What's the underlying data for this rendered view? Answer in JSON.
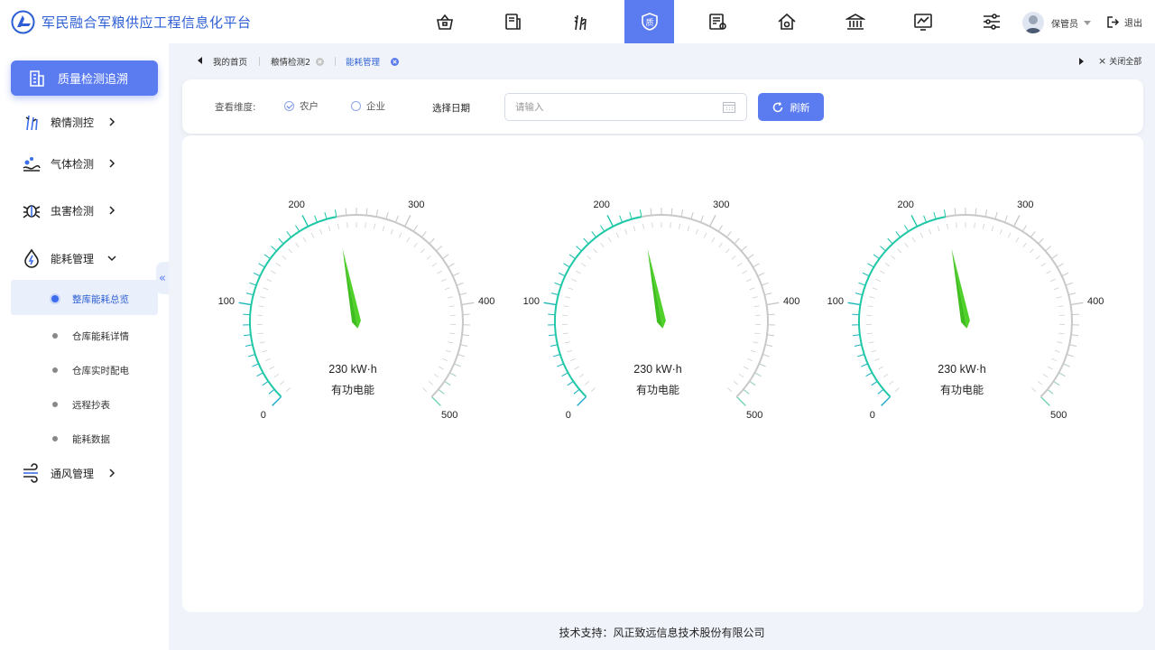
{
  "header": {
    "title": "军民融合军粮供应工程信息化平台",
    "nav_icons": [
      "storage-icon",
      "document-icon",
      "grain-icon",
      "quality-icon",
      "report-icon",
      "warehouse-icon",
      "bank-icon",
      "monitor-icon",
      "settings-sliders-icon"
    ],
    "active_nav_index": 3,
    "active_nav_label": "质",
    "user": "保管员",
    "logout": "退出"
  },
  "sidebar": {
    "primary": "质量检测追溯",
    "menus": [
      {
        "label": "粮情测控",
        "icon": "wheat-icon"
      },
      {
        "label": "气体检测",
        "icon": "gas-icon"
      },
      {
        "label": "虫害检测",
        "icon": "bug-icon"
      },
      {
        "label": "能耗管理",
        "icon": "energy-icon"
      },
      {
        "label": "通风管理",
        "icon": "wind-icon"
      }
    ],
    "subitems": [
      "整库能耗总览",
      "仓库能耗详情",
      "仓库实时配电",
      "远程抄表",
      "能耗数据"
    ],
    "active_sub": 0,
    "collapse_glyph": "«"
  },
  "tabs": {
    "items": [
      "我的首页",
      "粮情检测2",
      "能耗管理"
    ],
    "active": 2,
    "close_all": "关闭全部"
  },
  "filter": {
    "dimension_label": "查看维度:",
    "options": [
      "农户",
      "企业"
    ],
    "selected": 0,
    "date_label": "选择日期",
    "date_placeholder": "请输入",
    "refresh": "刷新"
  },
  "gauges": [
    {
      "value": 230,
      "unit": "kW·h",
      "display": "230 kW·h",
      "name": "有功电能",
      "min": 0,
      "max": 500,
      "labels": [
        "0",
        "100",
        "200",
        "300",
        "400",
        "500"
      ]
    },
    {
      "value": 230,
      "unit": "kW·h",
      "display": "230 kW·h",
      "name": "有功电能",
      "min": 0,
      "max": 500,
      "labels": [
        "0",
        "100",
        "200",
        "300",
        "400",
        "500"
      ]
    },
    {
      "value": 230,
      "unit": "kW·h",
      "display": "230 kW·h",
      "name": "有功电能",
      "min": 0,
      "max": 500,
      "labels": [
        "0",
        "100",
        "200",
        "300",
        "400",
        "500"
      ]
    }
  ],
  "colors": {
    "accent": "#5b7bf0",
    "needle": "#3fbf1f",
    "arc_start": "#16a9c9",
    "arc_mid": "#1fc8a6",
    "arc_rest": "#c8c8c8"
  },
  "footer": "技术支持：风正致远信息技术股份有限公司"
}
